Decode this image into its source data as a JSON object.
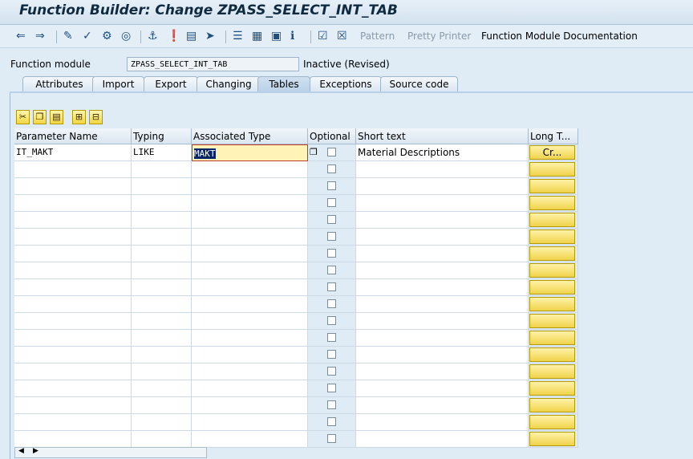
{
  "window": {
    "title": "Function Builder: Change ZPASS_SELECT_INT_TAB"
  },
  "toolbar": {
    "icons": [
      "back-icon",
      "forward-icon",
      "pencil-glasses-icon",
      "check-icon",
      "activate-icon",
      "test-icon",
      "where-used-icon",
      "info-marker-icon",
      "display-object-list-icon",
      "navigation-icon",
      "hierarchy-icon",
      "stack-icon",
      "frame-icon",
      "info-icon",
      "checkmark-list-icon",
      "delete-icon"
    ],
    "pattern": "Pattern",
    "pretty_printer": "Pretty Printer",
    "documentation": "Function Module Documentation"
  },
  "header": {
    "fm_label": "Function module",
    "fm_value": "ZPASS_SELECT_INT_TAB",
    "status": "Inactive (Revised)"
  },
  "tabs": [
    "Attributes",
    "Import",
    "Export",
    "Changing",
    "Tables",
    "Exceptions",
    "Source code"
  ],
  "active_tab": "Tables",
  "table": {
    "columns": [
      "Parameter Name",
      "Typing",
      "Associated Type",
      "Optional",
      "Short text",
      "Long T..."
    ],
    "rows": [
      {
        "name": "IT_MAKT",
        "typing": "LIKE",
        "assoc": "MAKT",
        "optional": false,
        "short": "Material Descriptions",
        "long": "Cr..."
      }
    ],
    "empty_rows": 17
  },
  "colors": {
    "background": "#dfebf5",
    "header_bg": "#dbe6f0",
    "highlight_field": "#fff3b8",
    "button_yellow": "#f0d34b"
  }
}
